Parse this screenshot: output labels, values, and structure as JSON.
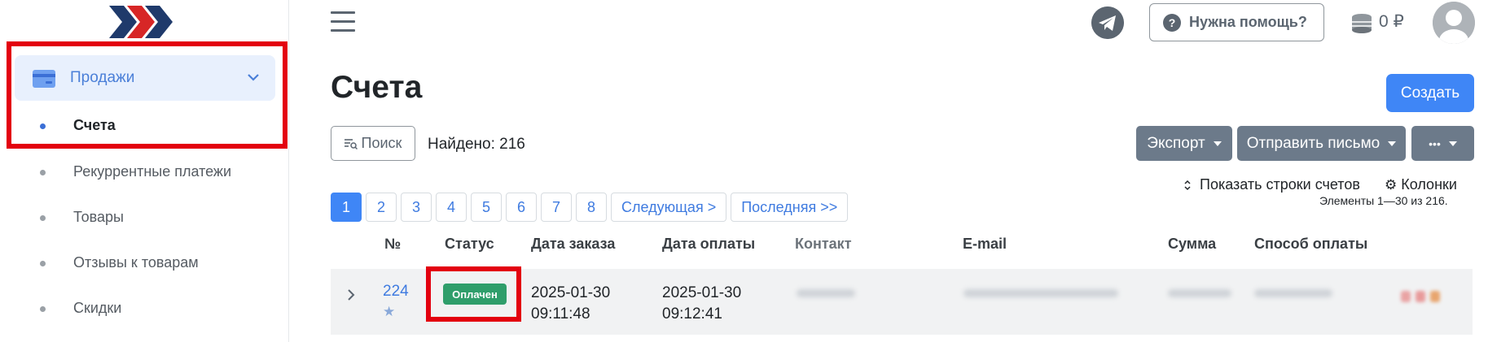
{
  "sidebar": {
    "group_label": "Продажи",
    "items": [
      {
        "label": "Счета",
        "active": true
      },
      {
        "label": "Рекуррентные платежи",
        "active": false
      },
      {
        "label": "Товары",
        "active": false
      },
      {
        "label": "Отзывы к товарам",
        "active": false
      },
      {
        "label": "Скидки",
        "active": false
      }
    ]
  },
  "header": {
    "help_label": "Нужна помощь?",
    "help_icon": "?",
    "balance": "0 ₽"
  },
  "page": {
    "title": "Счета",
    "create_label": "Создать",
    "search_label": "Поиск",
    "found_text": "Найдено: 216",
    "export_label": "Экспорт",
    "send_label": "Отправить письмо",
    "more_label": "•••",
    "show_rows_label": "Показать строки счетов",
    "columns_label": "Колонки",
    "elements_text": "Элементы 1—30 из 216."
  },
  "pagination": {
    "pages": [
      "1",
      "2",
      "3",
      "4",
      "5",
      "6",
      "7",
      "8"
    ],
    "next_label": "Следующая >",
    "last_label": "Последняя >>",
    "current": "1"
  },
  "table": {
    "headers": {
      "num": "№",
      "status": "Статус",
      "order_date": "Дата заказа",
      "payment_date": "Дата оплаты",
      "contact": "Контакт",
      "email": "E-mail",
      "sum": "Сумма",
      "payment_method": "Способ оплаты"
    },
    "rows": [
      {
        "num": "224",
        "star": "★",
        "status": "Оплачен",
        "order_date_1": "2025-01-30",
        "order_date_2": "09:11:48",
        "payment_date_1": "2025-01-30",
        "payment_date_2": "09:12:41"
      }
    ]
  },
  "colors": {
    "accent": "#3f86f6",
    "status_paid": "#2f9e6b",
    "highlight": "#e3000f",
    "dropdown_bg": "#6c7a8a"
  }
}
